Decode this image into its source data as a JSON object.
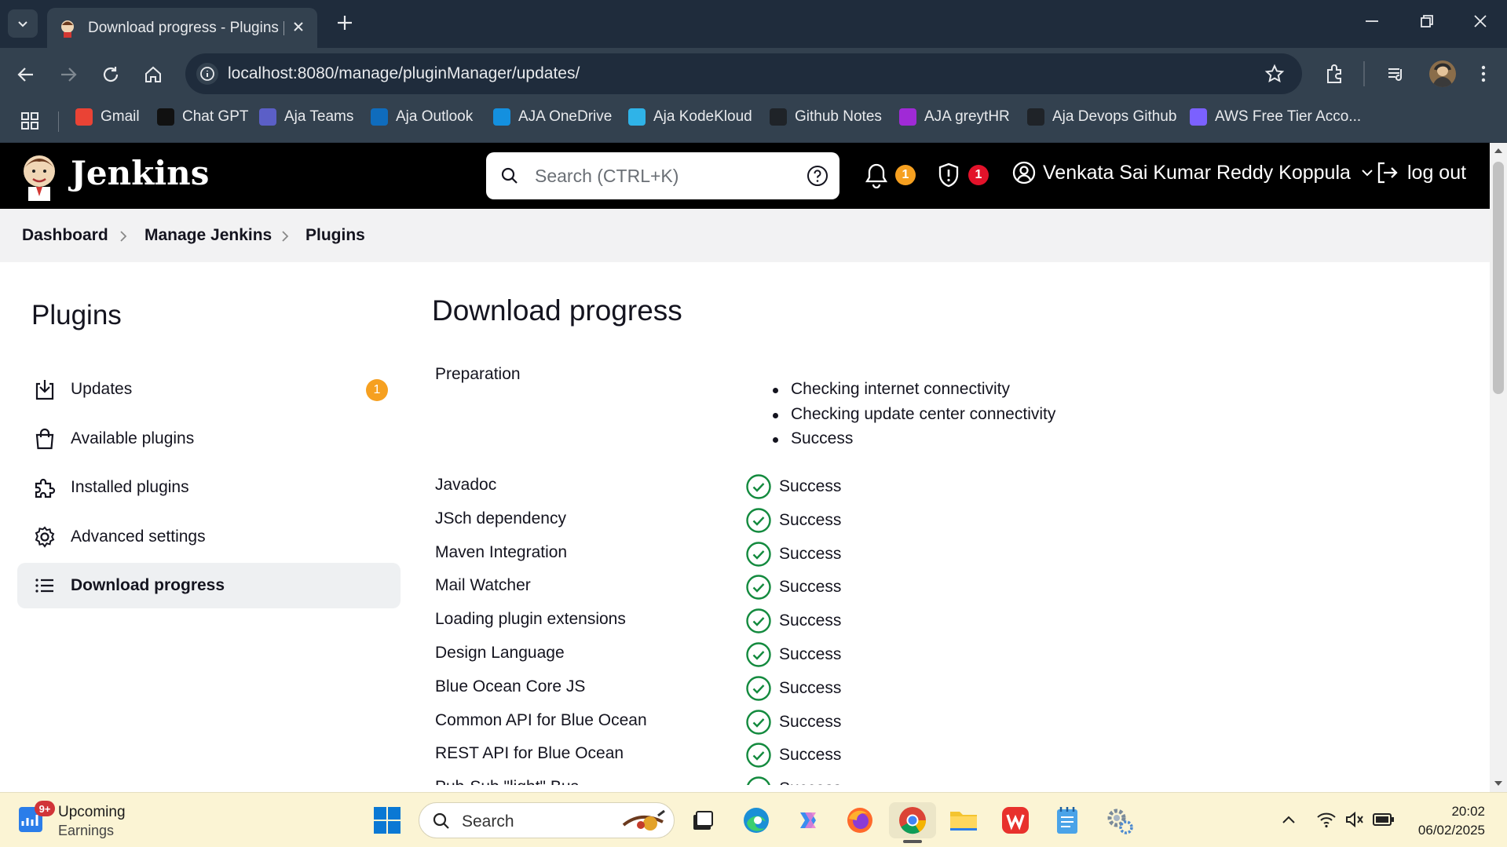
{
  "browser": {
    "tab_title": "Download progress - Plugins [J…",
    "url": "localhost:8080/manage/pluginManager/updates/",
    "bookmarks": [
      {
        "label": "Gmail",
        "icon": "gmail-icon",
        "color": "#ea4335"
      },
      {
        "label": "Chat GPT",
        "icon": "chatgpt-icon",
        "color": "#111111"
      },
      {
        "label": "Aja Teams",
        "icon": "teams-icon",
        "color": "#5b5fc7"
      },
      {
        "label": "Aja Outlook",
        "icon": "outlook-icon",
        "color": "#0f6cbd"
      },
      {
        "label": "AJA OneDrive",
        "icon": "onedrive-icon",
        "color": "#1490df"
      },
      {
        "label": "Aja KodeKloud",
        "icon": "kodekloud-icon",
        "color": "#2fb3e8"
      },
      {
        "label": "Github Notes",
        "icon": "github-icon",
        "color": "#1f2328"
      },
      {
        "label": "AJA greytHR",
        "icon": "greythr-icon",
        "color": "#a02ad6"
      },
      {
        "label": "Aja Devops Github",
        "icon": "github-icon",
        "color": "#1f2328"
      },
      {
        "label": "AWS Free Tier Acco...",
        "icon": "aws-icon",
        "color": "#7b61ff"
      }
    ]
  },
  "jenkins": {
    "title": "Jenkins",
    "search_placeholder": "Search (CTRL+K)",
    "notifications_count": "1",
    "security_count": "1",
    "user_name": "Venkata Sai Kumar Reddy Koppula",
    "logout_label": "log out",
    "colors": {
      "notif_badge": "#f6a020",
      "security_badge": "#e3122a",
      "success": "#138a3e"
    }
  },
  "breadcrumb": [
    "Dashboard",
    "Manage Jenkins",
    "Plugins"
  ],
  "sidebar": {
    "title": "Plugins",
    "items": [
      {
        "label": "Updates",
        "icon": "download-tray-icon",
        "badge": "1"
      },
      {
        "label": "Available plugins",
        "icon": "shopping-bag-icon"
      },
      {
        "label": "Installed plugins",
        "icon": "puzzle-icon"
      },
      {
        "label": "Advanced settings",
        "icon": "gear-icon"
      },
      {
        "label": "Download progress",
        "icon": "list-icon",
        "active": true
      }
    ]
  },
  "main": {
    "title": "Download progress",
    "preparation": {
      "label": "Preparation",
      "steps": [
        "Checking internet connectivity",
        "Checking update center connectivity",
        "Success"
      ]
    },
    "rows": [
      {
        "name": "Javadoc",
        "status": "Success"
      },
      {
        "name": "JSch dependency",
        "status": "Success"
      },
      {
        "name": "Maven Integration",
        "status": "Success"
      },
      {
        "name": "Mail Watcher",
        "status": "Success"
      },
      {
        "name": "Loading plugin extensions",
        "status": "Success"
      },
      {
        "name": "Design Language",
        "status": "Success"
      },
      {
        "name": "Blue Ocean Core JS",
        "status": "Success"
      },
      {
        "name": "Common API for Blue Ocean",
        "status": "Success"
      },
      {
        "name": "REST API for Blue Ocean",
        "status": "Success"
      },
      {
        "name": "Pub-Sub \"light\" Bus",
        "status": "Success"
      }
    ]
  },
  "taskbar": {
    "weather_badge": "9+",
    "weather_title": "Upcoming",
    "weather_sub": "Earnings",
    "search_label": "Search",
    "time": "20:02",
    "date": "06/02/2025"
  }
}
